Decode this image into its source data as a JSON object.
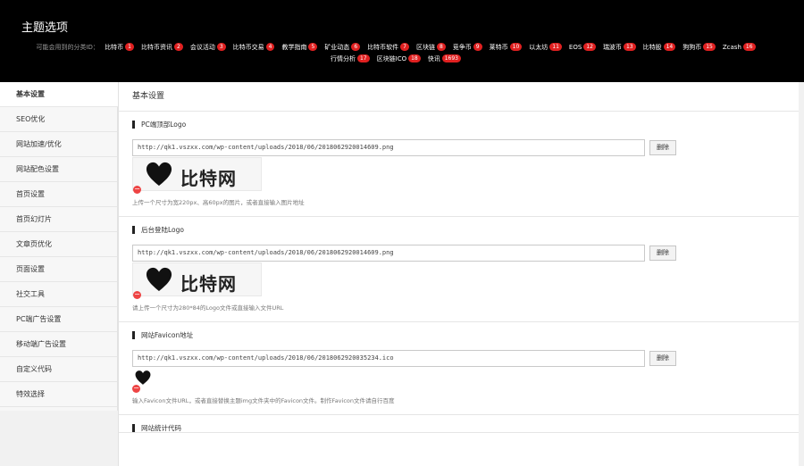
{
  "header": {
    "title": "主题选项",
    "categories_intro": "可能会用到的分类ID：",
    "categories": [
      {
        "name": "比特币",
        "id": "1"
      },
      {
        "name": "比特币资讯",
        "id": "2"
      },
      {
        "name": "会议活动",
        "id": "3"
      },
      {
        "name": "比特币交易",
        "id": "4"
      },
      {
        "name": "教学指南",
        "id": "5"
      },
      {
        "name": "矿业动态",
        "id": "6"
      },
      {
        "name": "比特币软件",
        "id": "7"
      },
      {
        "name": "区块链",
        "id": "8"
      },
      {
        "name": "竞争币",
        "id": "9"
      },
      {
        "name": "莱特币",
        "id": "10"
      },
      {
        "name": "以太坊",
        "id": "11"
      },
      {
        "name": "EOS",
        "id": "12"
      },
      {
        "name": "瑞波币",
        "id": "13"
      },
      {
        "name": "比特股",
        "id": "14"
      },
      {
        "name": "狗狗币",
        "id": "15"
      },
      {
        "name": "Zcash",
        "id": "16"
      },
      {
        "name": "行情分析",
        "id": "17"
      },
      {
        "name": "区块链ICO",
        "id": "18"
      },
      {
        "name": "快讯",
        "id": "1693"
      }
    ]
  },
  "sidebar": {
    "items": [
      {
        "label": "基本设置",
        "active": true
      },
      {
        "label": "SEO优化"
      },
      {
        "label": "网站加速/优化"
      },
      {
        "label": "网站配色设置"
      },
      {
        "label": "首页设置"
      },
      {
        "label": "首页幻灯片"
      },
      {
        "label": "文章页优化"
      },
      {
        "label": "页面设置"
      },
      {
        "label": "社交工具"
      },
      {
        "label": "PC端广告设置"
      },
      {
        "label": "移动端广告设置"
      },
      {
        "label": "自定义代码"
      },
      {
        "label": "特效选择"
      }
    ]
  },
  "main": {
    "page_title": "基本设置",
    "pc_logo": {
      "label": "PC端顶部Logo",
      "value": "http://qk1.vszxx.com/wp-content/uploads/2018/06/2018062920014609.png",
      "delete_label": "删除",
      "preview_text": "比特网",
      "hint": "上传一个尺寸为宽220px、高60px的图片，或者直接输入图片地址"
    },
    "admin_logo": {
      "label": "后台登陆Logo",
      "value": "http://qk1.vszxx.com/wp-content/uploads/2018/06/2018062920014609.png",
      "delete_label": "删除",
      "preview_text": "比特网",
      "hint": "请上传一个尺寸为280*84的Logo文件或直接输入文件URL"
    },
    "favicon": {
      "label": "网站Favicon地址",
      "value": "http://qk1.vszxx.com/wp-content/uploads/2018/06/2018062920035234.ico",
      "delete_label": "删除",
      "hint": "输入Favicon文件URL，或者直接替换主题img文件夹中的Favicon文件。制作Favicon文件请自行百度"
    },
    "stats_code": {
      "label": "网站统计代码"
    }
  }
}
